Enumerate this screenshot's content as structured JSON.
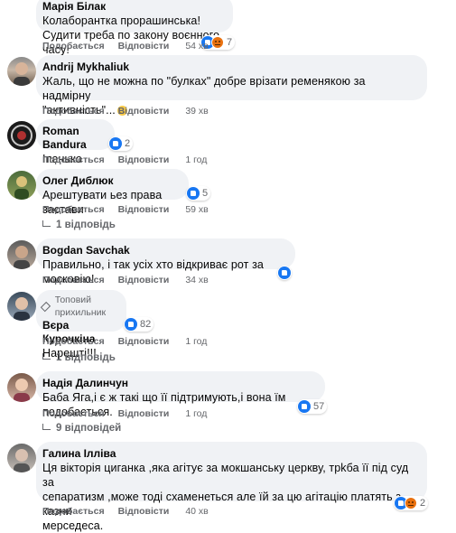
{
  "actions": {
    "like": "Подобається",
    "reply": "Відповісти"
  },
  "comments": [
    {
      "author": "Марія Білак",
      "lines": [
        "Колаборантка прорашинська!",
        "Судити треба по закону воєнного часу!"
      ],
      "time": "54 хв",
      "reaction_count": "7"
    },
    {
      "author": "Andrij Mykhaliuk",
      "lines": [
        "Жаль, що не можна по \"булках\" добре врізати ременякою за надмірну",
        "\"активність\"..."
      ],
      "time": "39 хв"
    },
    {
      "author": "Roman Bandura",
      "lines": [
        "Іпанько"
      ],
      "time": "1 год",
      "reaction_count": "2"
    },
    {
      "author": "Олег Диблюк",
      "lines": [
        "Арештувати ьез права застави"
      ],
      "time": "59 хв",
      "reaction_count": "5",
      "replies": "1 відповідь"
    },
    {
      "author": "Bogdan Savchak",
      "lines": [
        "Правильно, і так усіх хто відкриває рот за московію!"
      ],
      "time": "34 хв"
    },
    {
      "author": "Вєра Курочкіна",
      "badge": "Топовий прихильник",
      "lines": [
        "Нарешті!!!"
      ],
      "time": "1 год",
      "reaction_count": "82",
      "replies": "1 відповідь"
    },
    {
      "author": "Надія Далинчун",
      "lines": [
        "Баба Яга,і є ж такі що її підтримують,і вона їм подобається."
      ],
      "time": "1 год",
      "reaction_count": "57",
      "replies": "9 відповідей"
    },
    {
      "author": "Галина Ілліва",
      "lines": [
        "Ця вікторія циганка ,яка агітує за мокшанську церкву, трkба її під суд за",
        "сепаратизм ,може тоді схаменеться але їй за цю агітацію платять з казни",
        "мерседеса."
      ],
      "time": "40 хв",
      "reaction_count": "2"
    }
  ]
}
